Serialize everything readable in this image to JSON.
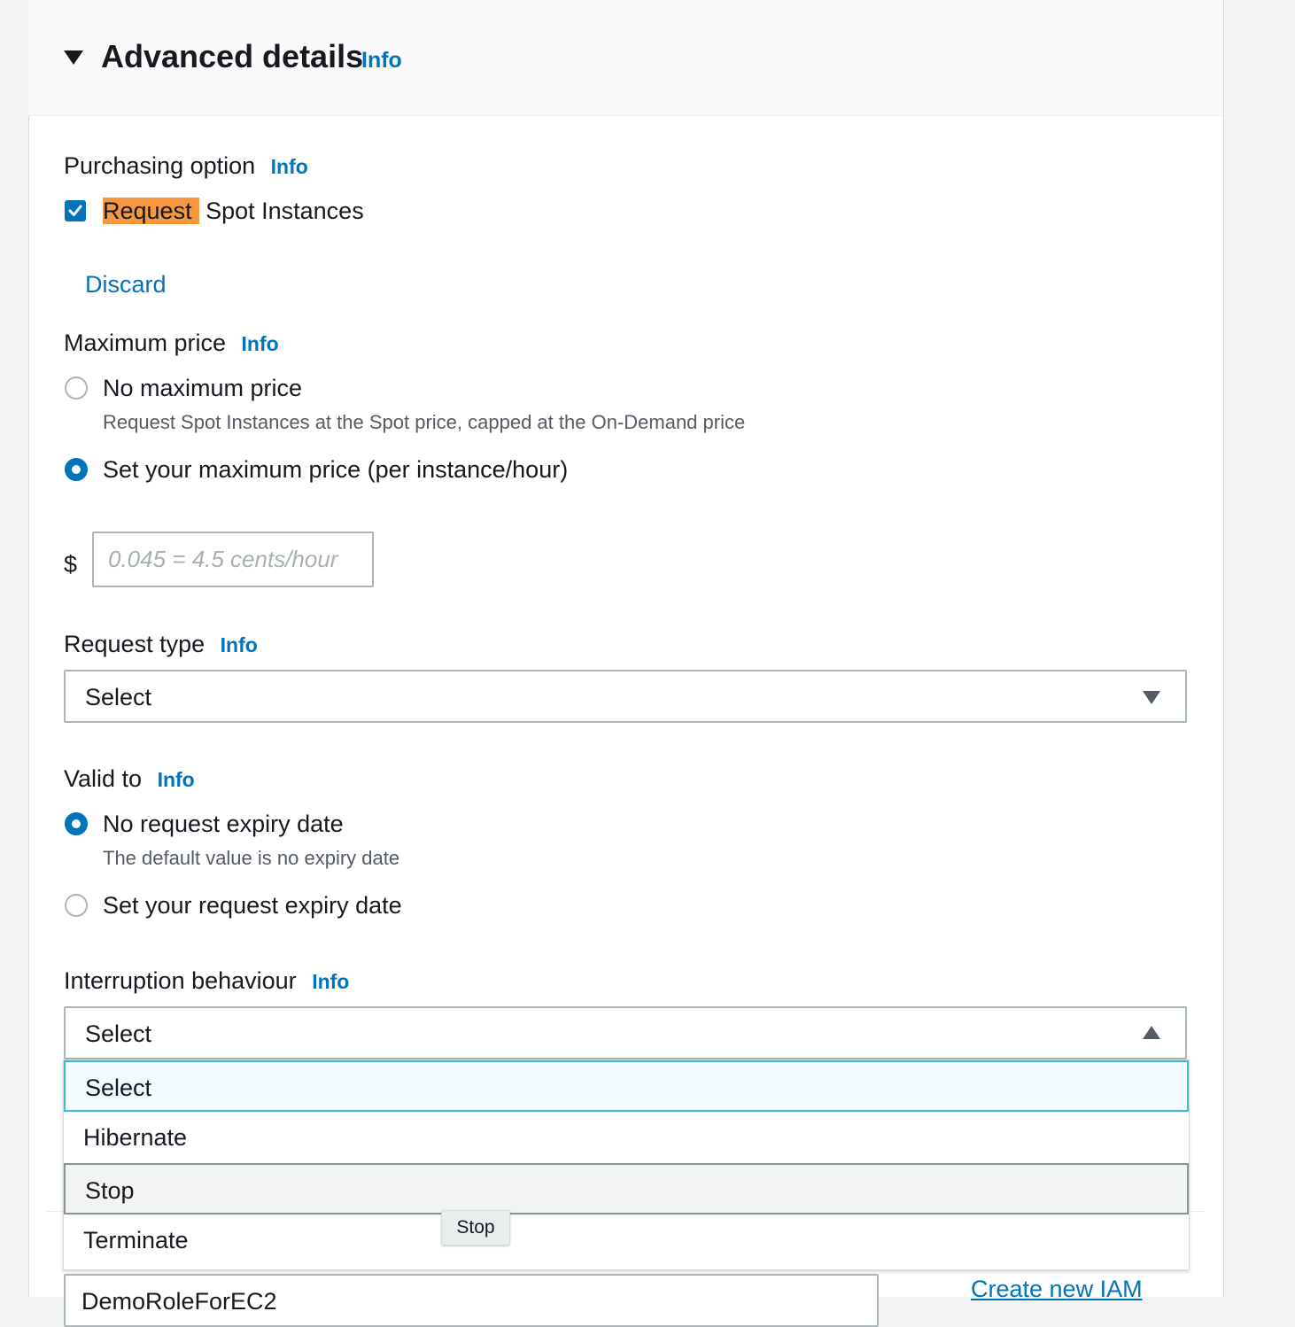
{
  "section": {
    "title": "Advanced details",
    "info": "Info"
  },
  "purchasing": {
    "label": "Purchasing option",
    "info": "Info",
    "checkbox_highlight": "Request",
    "checkbox_rest": " Spot Instances",
    "checked": true
  },
  "discard_label": "Discard",
  "max_price": {
    "label": "Maximum price",
    "info": "Info",
    "option1": "No maximum price",
    "option1_desc": "Request Spot Instances at the Spot price, capped at the On-Demand price",
    "option2": "Set your maximum price (per instance/hour)",
    "currency": "$",
    "placeholder": "0.045 = 4.5 cents/hour",
    "value": ""
  },
  "request_type": {
    "label": "Request type",
    "info": "Info",
    "value": "Select"
  },
  "valid_to": {
    "label": "Valid to",
    "info": "Info",
    "option1": "No request expiry date",
    "option1_desc": "The default value is no expiry date",
    "option2": "Set your request expiry date"
  },
  "interruption": {
    "label": "Interruption behaviour",
    "info": "Info",
    "value": "Select",
    "options": [
      "Select",
      "Hibernate",
      "Stop",
      "Terminate"
    ],
    "tooltip": "Stop"
  },
  "iam": {
    "value": "DemoRoleForEC2",
    "create_link": "Create new IAM"
  },
  "colors": {
    "accent": "#0073bb",
    "highlight": "#f79841",
    "text": "#16191f"
  }
}
